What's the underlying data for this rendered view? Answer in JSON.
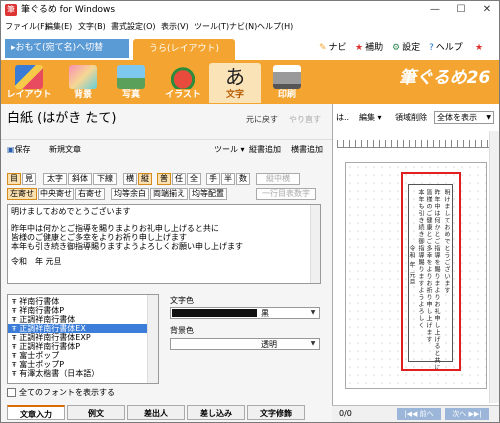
{
  "window": {
    "title": "筆ぐるめ for Windows",
    "minimize": "—",
    "maximize": "☐",
    "close": "✕"
  },
  "menu": [
    "ファイル(F)",
    "編集(E)",
    "文字(B)",
    "書式設定(O)",
    "表示(V)",
    "ツール(T)",
    "ナビ(N)",
    "ヘルプ(H)"
  ],
  "top": {
    "switch_button": "▸おもて(宛て名)へ切替",
    "layout_tab": "うら(レイアウト)",
    "links": [
      {
        "icon": "✎",
        "label": "ナビ",
        "color": "#f4a531"
      },
      {
        "icon": "★",
        "label": "補助",
        "color": "#e03030"
      },
      {
        "icon": "⚙",
        "label": "設定",
        "color": "#2e8b57"
      },
      {
        "icon": "?",
        "label": "ヘルプ",
        "color": "#1e6fcf"
      },
      {
        "icon": "★",
        "label": "",
        "color": "#e03030"
      }
    ]
  },
  "categories": [
    {
      "label": "レイアウト",
      "active": false
    },
    {
      "label": "背景",
      "active": false
    },
    {
      "label": "写真",
      "active": false
    },
    {
      "label": "イラスト",
      "active": false
    },
    {
      "label": "文字",
      "active": true
    },
    {
      "label": "印刷",
      "active": false
    }
  ],
  "brand": "筆ぐるめ26",
  "doc": {
    "title": "白紙 (はがき たて)",
    "undo": "元に戻す",
    "redo": "やり直す"
  },
  "toolbar": {
    "save": "保存",
    "new_text": "新規文章",
    "tool": "ツール",
    "vertical_add": "縦書追加",
    "horizontal_add": "横書追加"
  },
  "format_row1": [
    "目",
    "見",
    "太字",
    "斜体",
    "下線",
    "横",
    "縦",
    "普",
    "任",
    "全",
    "手",
    "半",
    "数",
    "縦中横"
  ],
  "format_row2": [
    "左寄せ",
    "中央寄せ",
    "右寄せ",
    "均等余白",
    "両端揃え",
    "均等配置",
    "一行目表数字"
  ],
  "editor_lines": [
    "明けましておめでとうございます",
    "",
    "昨年中は何かとご指導を賜りまよりお礼申し上げると共に",
    "皆様のご健康とご多幸をよりお祈り申し上げます",
    "本年も引き続き御指導賜りますようよろしくお願い申し上げます",
    "",
    "令和　年 元旦"
  ],
  "fonts": [
    "祥南行書体",
    "祥南行書体P",
    "正調祥南行書体",
    "正調祥南行書体EX",
    "正調祥南行書体EXP",
    "正調祥南行書体P",
    "富士ポップ",
    "富士ポップP",
    "有澤太楷書（日本語）"
  ],
  "selected_font_index": 3,
  "show_all_fonts": "全てのフォントを表示する",
  "text_color": {
    "label": "文字色",
    "value": "黒"
  },
  "bg_color": {
    "label": "背景色",
    "value": "透明"
  },
  "bottom_tabs": [
    "文章入力",
    "例文",
    "差出人",
    "差し込み",
    "文字修飾"
  ],
  "right": {
    "tool1": "は..",
    "tool2": "編集",
    "tool3": "領域削除",
    "view_select": "全体を表示",
    "pager": "0/0",
    "prev": "|◀◀ 前へ",
    "next": "次へ ▶▶|"
  },
  "preview_columns": [
    "明けましておめでとうございます",
    "昨年中は何かとご指導を賜りまよりお礼申し上げると共に",
    "皆様のご健康とご多幸をよりお祈り申し上げます",
    "本年も引き続き御指導賜りますようよろしく",
    "令和 年 元旦"
  ]
}
